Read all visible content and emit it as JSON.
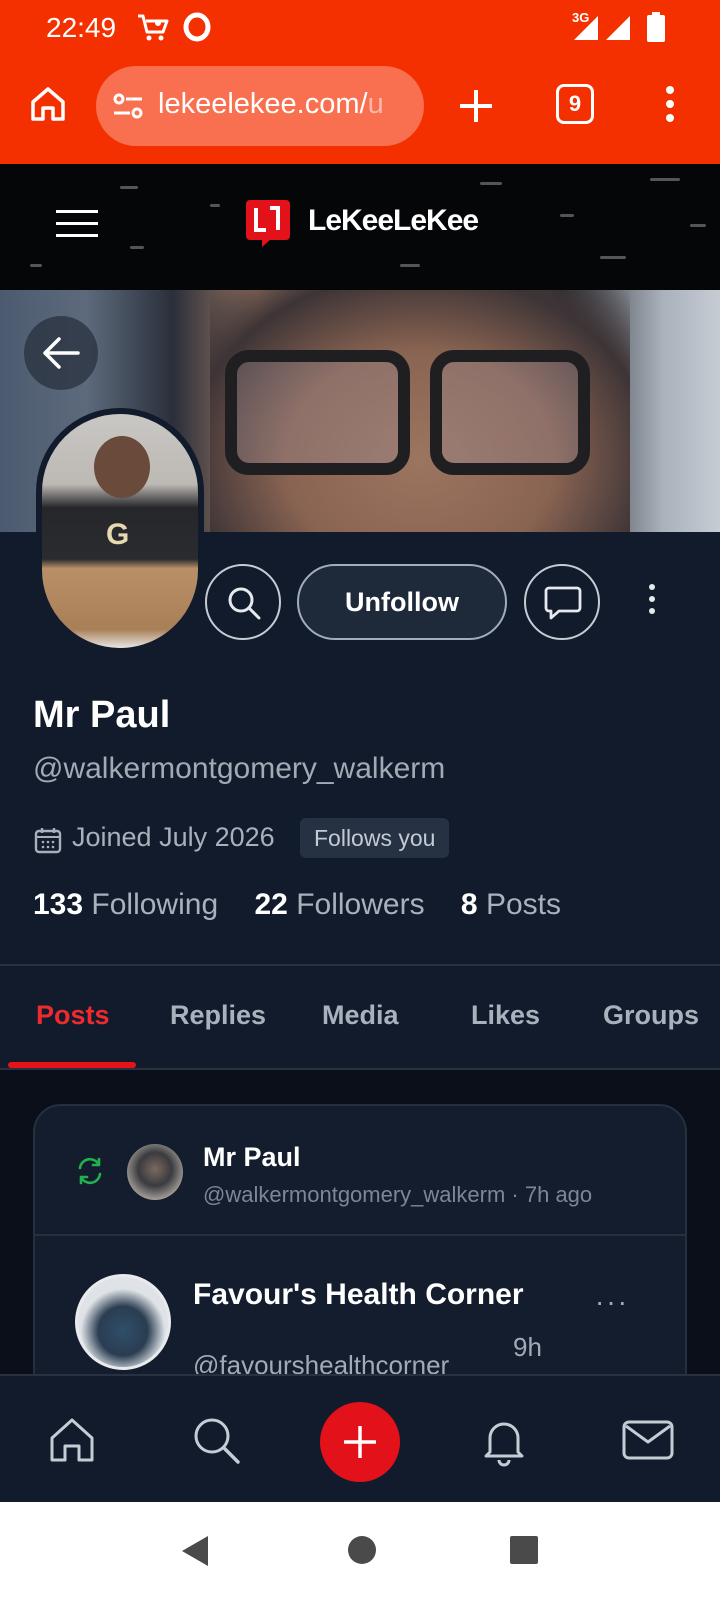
{
  "status_bar": {
    "time": "22:49",
    "network": "3G"
  },
  "browser": {
    "url_main": "lekeelekee.com/",
    "url_tail": "u",
    "tab_count": "9"
  },
  "site": {
    "brand_name": "LeKeeLeKee",
    "brand_color": "#e3111a"
  },
  "profile": {
    "display_name": "Mr Paul",
    "handle": "@walkermontgomery_walkerm",
    "joined": "Joined July 2026",
    "follows_you": "Follows you",
    "unfollow_label": "Unfollow",
    "stats": {
      "following_count": "133",
      "following_label": "Following",
      "followers_count": "22",
      "followers_label": "Followers",
      "posts_count": "8",
      "posts_label": "Posts"
    }
  },
  "tabs": [
    {
      "label": "Posts",
      "active": true
    },
    {
      "label": "Replies",
      "active": false
    },
    {
      "label": "Media",
      "active": false
    },
    {
      "label": "Likes",
      "active": false
    },
    {
      "label": "Groups",
      "active": false
    }
  ],
  "feed": {
    "repost": {
      "name": "Mr Paul",
      "meta": "@walkermontgomery_walkerm · 7h ago"
    },
    "post": {
      "author": "Favour's Health Corner",
      "handle": "@favourshealthcorner",
      "time": "9h",
      "more": "···"
    }
  },
  "icons": {
    "status": [
      "cart-icon",
      "opera-icon",
      "signal-icon",
      "battery-icon"
    ],
    "browser": [
      "home-icon",
      "site-settings-icon",
      "new-tab-icon",
      "tabs-icon",
      "menu-icon"
    ],
    "profile": [
      "back-arrow-icon",
      "search-icon",
      "message-icon",
      "more-icon",
      "calendar-icon",
      "repost-icon"
    ],
    "bottom_nav": [
      "home-icon",
      "search-icon",
      "plus-icon",
      "bell-icon",
      "mail-icon"
    ]
  }
}
